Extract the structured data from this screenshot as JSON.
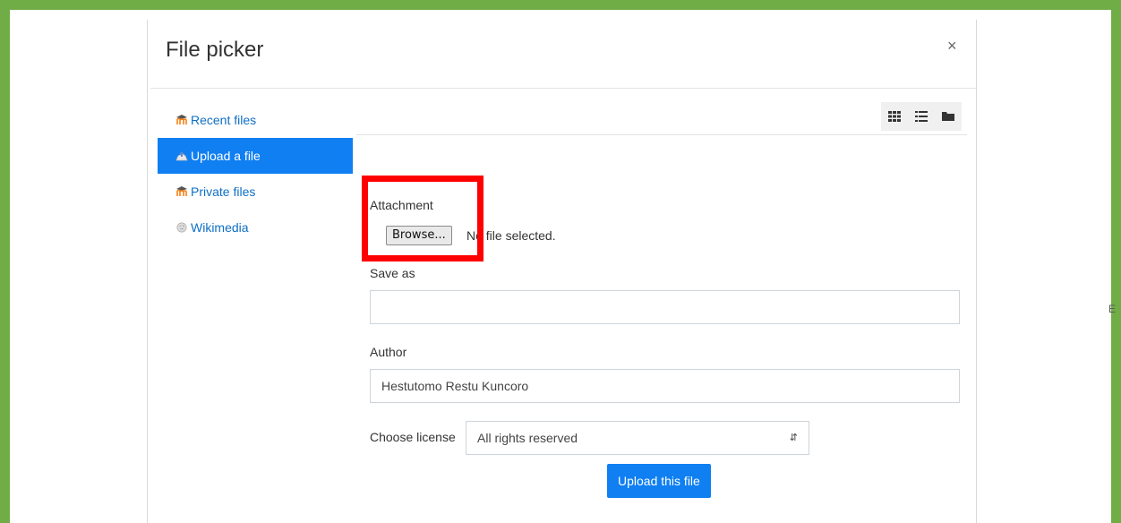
{
  "dialog": {
    "title": "File picker",
    "close_symbol": "×"
  },
  "sidebar": {
    "items": [
      {
        "label": "Recent files",
        "icon": "moodle-icon",
        "active": false
      },
      {
        "label": "Upload a file",
        "icon": "upload-icon",
        "active": true
      },
      {
        "label": "Private files",
        "icon": "moodle-icon",
        "active": false
      },
      {
        "label": "Wikimedia",
        "icon": "wikimedia-icon",
        "active": false
      }
    ]
  },
  "toolbar": {
    "views": [
      "grid-view-icon",
      "list-view-icon",
      "folder-view-icon"
    ]
  },
  "form": {
    "attachment_label": "Attachment",
    "browse_label": "Browse...",
    "no_file_text": "No file selected.",
    "save_as_label": "Save as",
    "save_as_value": "",
    "author_label": "Author",
    "author_value": "Hestutomo Restu Kuncoro",
    "license_label": "Choose license",
    "license_value": "All rights reserved",
    "upload_label": "Upload this file"
  },
  "colors": {
    "frame": "#70ad47",
    "accent": "#0f7ff2",
    "link": "#0f6fc5",
    "highlight": "#ff0000"
  },
  "background_hint": "E"
}
